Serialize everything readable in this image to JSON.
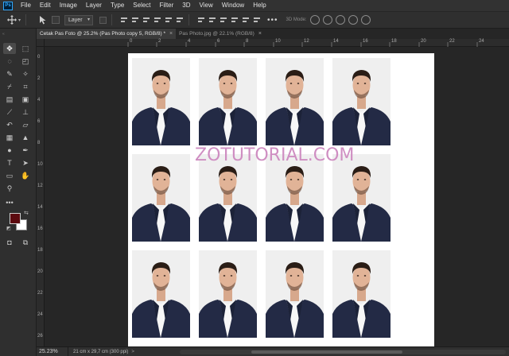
{
  "menubar": {
    "logo": "Ps",
    "items": [
      "File",
      "Edit",
      "Image",
      "Layer",
      "Type",
      "Select",
      "Filter",
      "3D",
      "View",
      "Window",
      "Help"
    ]
  },
  "options": {
    "auto_select_target": "Layer",
    "more_label": "•••",
    "mode_3d_label": "3D Mode:"
  },
  "tabs": [
    {
      "label": "Cetak Pas Foto @ 25.2% (Pas Photo copy 5, RGB/8) *",
      "close": "×",
      "active": true
    },
    {
      "label": "Pas Photo.jpg @ 22.1% (RGB/8)",
      "close": "×",
      "active": false
    }
  ],
  "ruler": {
    "top_ticks": [
      "0",
      "2",
      "4",
      "6",
      "8",
      "10",
      "12",
      "14",
      "16",
      "18",
      "20",
      "22",
      "24"
    ],
    "left_ticks": [
      "0",
      "2",
      "4",
      "6",
      "8",
      "10",
      "12",
      "14",
      "16",
      "18",
      "20",
      "22",
      "24",
      "26"
    ]
  },
  "canvas": {
    "watermark": "ZOTUTORIAL.COM",
    "photos": {
      "rows": 3,
      "cols": 4,
      "count": 12
    }
  },
  "status": {
    "zoom": "25.23%",
    "doc_info": "21 cm x 29,7 cm (300 ppi)",
    "arrow": ">"
  },
  "colors": {
    "foreground": "#5c0a0f",
    "background": "#ffffff",
    "watermark": "#cf8ec2",
    "suit": "#232a45"
  },
  "toolbar": {
    "tools": [
      "move-tool",
      "marquee-tool",
      "lasso-tool",
      "quick-select-tool",
      "crop-tool",
      "frame-tool",
      "eyedropper-tool",
      "spot-healing-tool",
      "brush-tool",
      "clone-stamp-tool",
      "history-brush-tool",
      "eraser-tool",
      "gradient-tool",
      "blur-tool",
      "dodge-tool",
      "pen-tool",
      "type-tool",
      "path-select-tool",
      "rectangle-tool",
      "hand-tool",
      "zoom-tool",
      "more-tools",
      "quick-mask",
      "screen-mode"
    ]
  }
}
